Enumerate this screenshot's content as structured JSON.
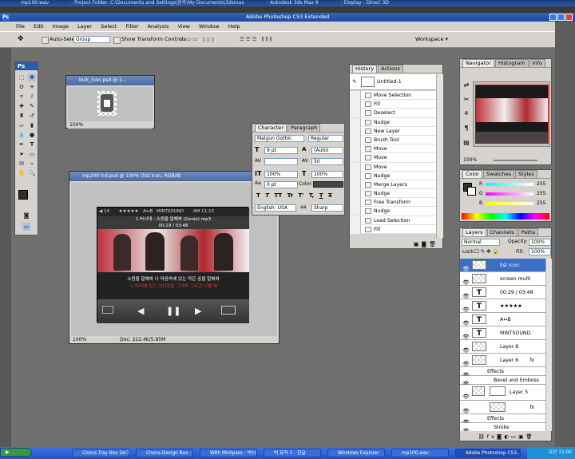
{
  "top_titles": [
    "mp100.wav",
    "- Project Folder: C:\\Documents and Settings\\현주\\My Documents\\3dsmax",
    "- Autodesk 3ds Max 9",
    "- Display : Direct 3D"
  ],
  "app_title": "Adobe Photoshop CS3 Extended",
  "ps_logo": "Ps",
  "menu": [
    "File",
    "Edit",
    "Image",
    "Layer",
    "Select",
    "Filter",
    "Analysis",
    "View",
    "Window",
    "Help"
  ],
  "options": {
    "auto_select": "Auto-Select:",
    "group": "Group",
    "show_transform": "Show Transform Controls",
    "workspace": "Workspace"
  },
  "lock_doc": {
    "title": "lock_icon.psd @ 1...",
    "zoom": "100%"
  },
  "main_doc": {
    "title": "mp200 lcd.psd @ 100% (list icon, RGB/8)",
    "zoom": "100%",
    "doc_size": "Doc: 222.4K/5.85M"
  },
  "player": {
    "volume": "14",
    "stars": "★★★★★",
    "repeat": "A↔B",
    "brand": "MINTSOUND",
    "clock": "AM 11:15",
    "song": "1.버시대 - 소원을 말해봐 (Genie).mp3",
    "time": "00:29 / 03:48",
    "lyric1": "소원을 말해봐 나 마음속에 있는 작은 꿈을 말해봐",
    "lyric2": "니 머리에 있는 이상형을 그려봐 그리고 나를 봐"
  },
  "character": {
    "tabs": [
      "Character",
      "Paragraph"
    ],
    "font": "Malgun Gothic",
    "style": "Regular",
    "size": "9 pt",
    "leading": "(Auto)",
    "tracking": "50",
    "scale_v": "100%",
    "scale_h": "100%",
    "baseline": "0 pt",
    "color_label": "Color:",
    "language": "English: USA",
    "aa_icon": "aa",
    "aa": "Sharp",
    "glyph_buttons": [
      "T",
      "T",
      "TT",
      "Tr",
      "T'",
      "T,",
      "T",
      "T"
    ]
  },
  "history": {
    "tabs": [
      "History",
      "Actions"
    ],
    "snapshot": "Untitled-1",
    "items": [
      "Move Selection",
      "Fill",
      "Deselect",
      "Nudge",
      "New Layer",
      "Brush Tool",
      "Move",
      "Move",
      "Move",
      "Nudge",
      "Merge Layers",
      "Nudge",
      "Free Transform",
      "Nudge",
      "Load Selection",
      "Fill"
    ]
  },
  "navigator": {
    "tabs": [
      "Navigator",
      "Histogram",
      "Info"
    ],
    "zoom": "100%"
  },
  "color": {
    "tabs": [
      "Color",
      "Swatches",
      "Styles"
    ],
    "r_label": "R",
    "g_label": "G",
    "b_label": "B",
    "r": "255",
    "g": "255",
    "b": "255"
  },
  "layers": {
    "tabs": [
      "Layers",
      "Channels",
      "Paths"
    ],
    "mode": "Normal",
    "opacity_label": "Opacity:",
    "opacity": "100%",
    "lock_label": "Lock:",
    "fill_label": "Fill:",
    "fill": "100%",
    "rows": [
      {
        "name": "list icon",
        "kind": "img",
        "sel": true
      },
      {
        "name": "screen multi",
        "kind": "img"
      },
      {
        "name": "00:29 / 03:48",
        "kind": "text"
      },
      {
        "name": "★★★★★",
        "kind": "text"
      },
      {
        "name": "A↔B",
        "kind": "text"
      },
      {
        "name": "MINTSOUND",
        "kind": "text"
      },
      {
        "name": "Layer 8",
        "kind": "img"
      },
      {
        "name": "Layer 6",
        "kind": "img",
        "fx": true
      }
    ],
    "effects_label": "Effects",
    "bevel": "Bevel and Emboss",
    "layer5": "Layer 5",
    "stroke": "Stroke"
  },
  "taskbar": {
    "tasks": [
      "Chens Tray Box 2sr3",
      "Chens Design Box - ...",
      "With Mintpass - 빅이...",
      "빅 뮤직 1 - 한글",
      "Windows Explorer",
      "mp100.wav",
      "Adobe Photoshop CS3..."
    ],
    "clock": "오전 11:00"
  },
  "colors": {
    "titlebar": "#2b5ea8",
    "panel": "#d6d3ce",
    "workspace": "#6f6f6f",
    "accent_red": "#c0303a"
  }
}
